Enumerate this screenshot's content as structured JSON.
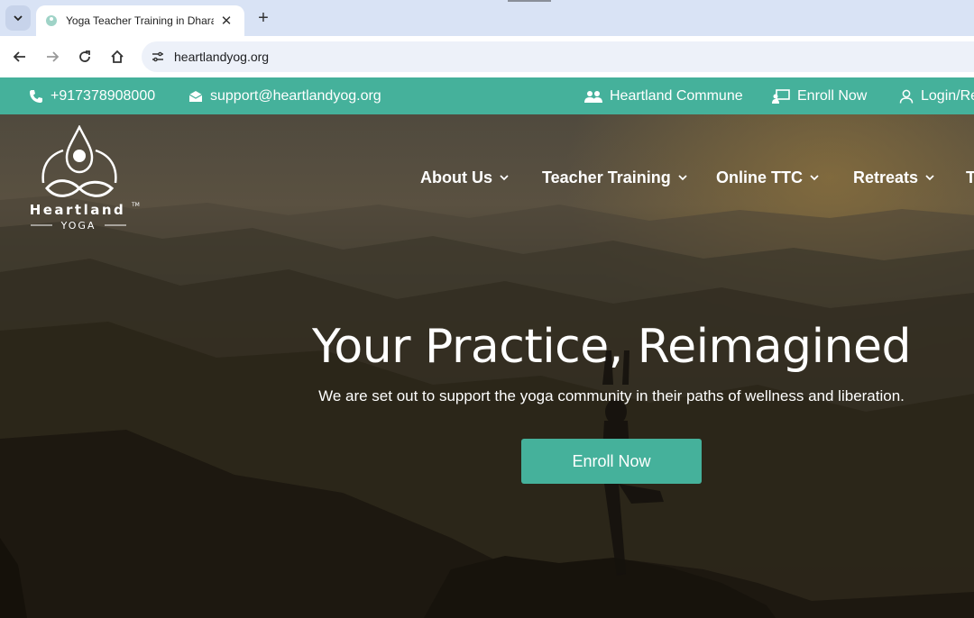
{
  "browser": {
    "tab_title": "Yoga Teacher Training in Dharamsala",
    "url": "heartlandyog.org",
    "new_tab_symbol": "+",
    "close_symbol": "✕"
  },
  "topbar": {
    "phone": "+917378908000",
    "email": "support@heartlandyog.org",
    "commune": "Heartland Commune",
    "enroll": "Enroll Now",
    "login": "Login/Register",
    "bg_color": "#45b19b"
  },
  "logo": {
    "brand": "Heartland",
    "sub": "YOGA",
    "tm": "TM"
  },
  "nav": {
    "items": [
      {
        "label": "About Us"
      },
      {
        "label": "Teacher Training"
      },
      {
        "label": "Online TTC"
      },
      {
        "label": "Retreats"
      },
      {
        "label": "T"
      }
    ]
  },
  "hero": {
    "title": "Your Practice, Reimagined",
    "subtitle": "We are set out to support the yoga community in their paths of wellness and liberation.",
    "cta": "Enroll Now"
  },
  "icons": {
    "phone": "phone-icon",
    "email": "email-icon",
    "commune": "users-icon",
    "enroll": "enroll-icon",
    "login": "user-icon"
  }
}
